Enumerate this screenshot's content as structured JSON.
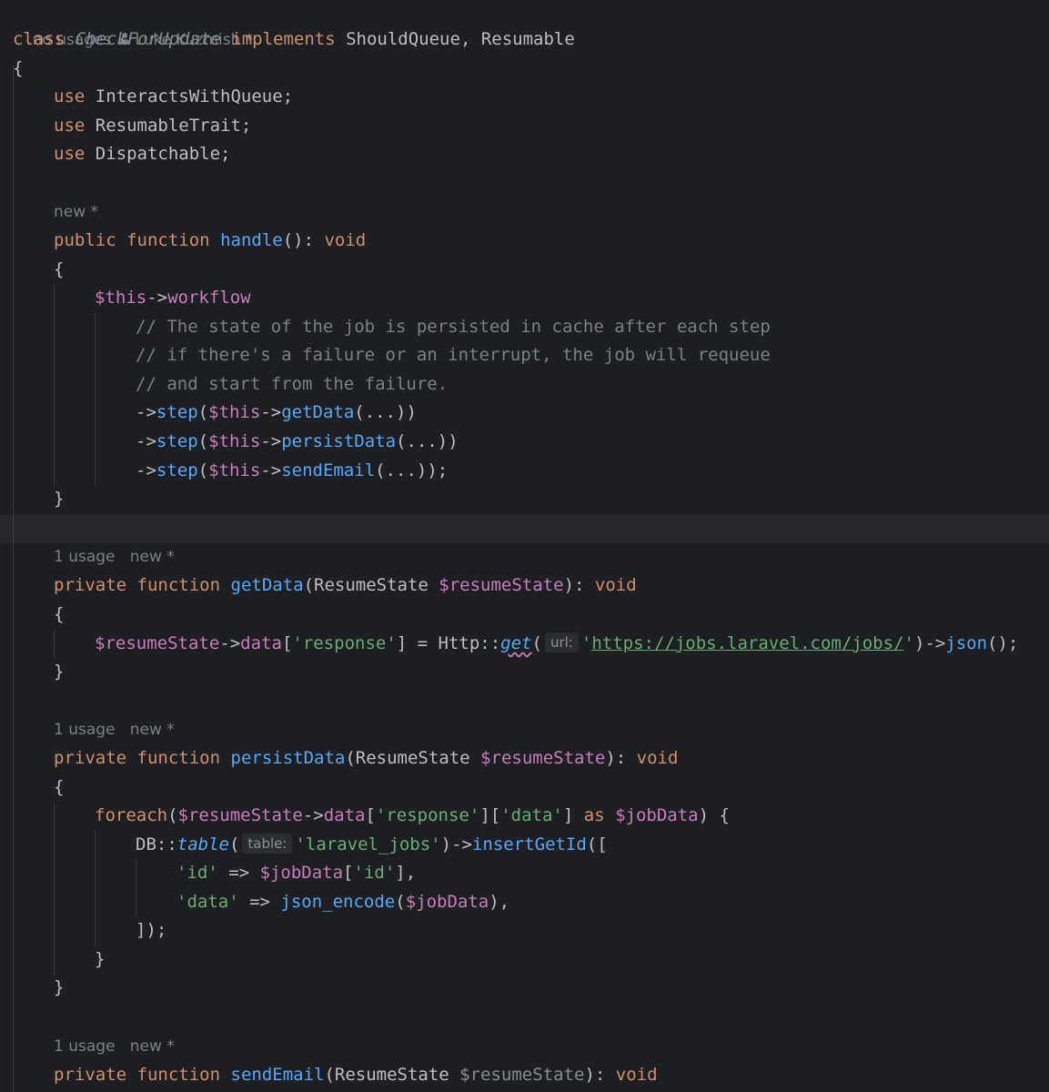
{
  "class_header": {
    "usages": "no usages",
    "author": "Luke Kuzmish *",
    "kw_class": "class",
    "name": "CheckForUpdate",
    "kw_implements": "implements",
    "interfaces": "ShouldQueue, Resumable",
    "open_brace": "{"
  },
  "traits": [
    {
      "kw": "use",
      "name": "InteractsWithQueue;"
    },
    {
      "kw": "use",
      "name": "ResumableTrait;"
    },
    {
      "kw": "use",
      "name": "Dispatchable;"
    }
  ],
  "handle": {
    "hint": "new *",
    "kw_public": "public",
    "kw_function": "function",
    "name": "handle",
    "sig": "(): ",
    "ret": "void",
    "open": "{",
    "this": "$this",
    "arrow": "->",
    "prop": "workflow",
    "comments": [
      "// The state of the job is persisted in cache after each step",
      "// if there's a failure or an interrupt, the job will requeue",
      "// and start from the failure."
    ],
    "steps": [
      {
        "call": "step",
        "method": "getData",
        "end": "(...))"
      },
      {
        "call": "step",
        "method": "persistData",
        "end": "(...))"
      },
      {
        "call": "step",
        "method": "sendEmail",
        "end": "(...));"
      }
    ],
    "close": "}"
  },
  "get_data": {
    "hint_usage": "1 usage",
    "hint_new": "new *",
    "kw_private": "private",
    "kw_function": "function",
    "name": "getData",
    "param_type": "(ResumeState ",
    "param_var": "$resumeState",
    "sig_end": "): ",
    "ret": "void",
    "open": "{",
    "body_var": "$resumeState",
    "body_arrow": "->",
    "body_prop": "data",
    "body_key_open": "[",
    "body_key": "'response'",
    "body_assign": "] = Http::",
    "body_fn": "get",
    "body_paren": "(",
    "inlay": "url:",
    "url_q1": "'",
    "url": "https://jobs.laravel.com/jobs/",
    "url_q2": "'",
    "body_tail_arrow": ")->",
    "body_tail_fn": "json",
    "body_tail_end": "();",
    "close": "}"
  },
  "persist_data": {
    "hint_usage": "1 usage",
    "hint_new": "new *",
    "kw_private": "private",
    "kw_function": "function",
    "name": "persistData",
    "param_type": "(ResumeState ",
    "param_var": "$resumeState",
    "sig_end": "): ",
    "ret": "void",
    "open": "{",
    "foreach_kw": "foreach",
    "foreach_paren": "(",
    "foreach_var": "$resumeState",
    "foreach_arrow": "->",
    "foreach_prop": "data",
    "foreach_b1": "[",
    "foreach_k1": "'response'",
    "foreach_b2": "][",
    "foreach_k2": "'data'",
    "foreach_b3": "] ",
    "foreach_as": "as",
    "foreach_sp": " ",
    "foreach_item": "$jobData",
    "foreach_end": ") {",
    "db_class": "DB::",
    "db_fn": "table",
    "db_paren": "(",
    "db_inlay": "table:",
    "db_table": "'laravel_jobs'",
    "db_arrow": ")->",
    "db_insert": "insertGetId",
    "db_open": "([",
    "row1_key": "'id'",
    "row1_arrow": " => ",
    "row1_var": "$jobData",
    "row1_b1": "[",
    "row1_k": "'id'",
    "row1_end": "],",
    "row2_key": "'data'",
    "row2_arrow": " => ",
    "row2_fn": "json_encode",
    "row2_paren": "(",
    "row2_var": "$jobData",
    "row2_end": "),",
    "close_array": "]);",
    "close_foreach": "}",
    "close": "}"
  },
  "send_email": {
    "hint_usage": "1 usage",
    "hint_new": "new *",
    "kw_private": "private",
    "kw_function": "function",
    "name": "sendEmail",
    "param_type": "(ResumeState ",
    "param_var": "$resumeState",
    "sig_end": "): ",
    "ret": "void"
  },
  "colors": {
    "background": "#1e1f22",
    "keyword": "#cf8e6d",
    "function": "#56a8f5",
    "variable": "#c77dbb",
    "string": "#6aab73",
    "comment": "#7a7e85",
    "text": "#bcbec4",
    "current_line": "#26282e"
  }
}
